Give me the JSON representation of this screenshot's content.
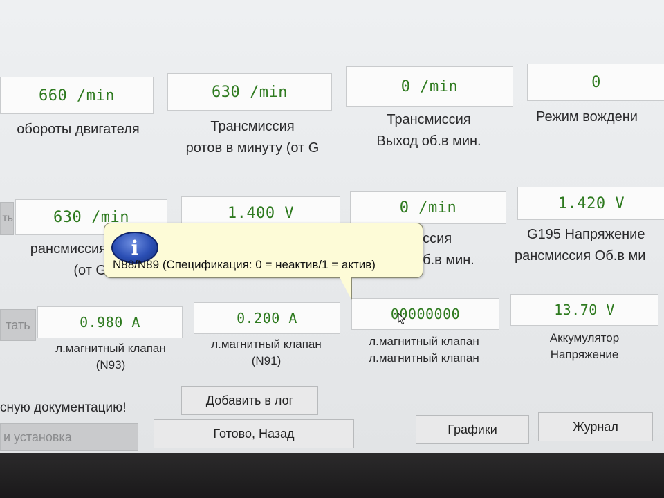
{
  "row1": {
    "values": [
      "660 /min",
      "630 /min",
      "0 /min",
      "0"
    ],
    "labels": [
      [
        "обороты двигателя",
        ""
      ],
      [
        "Трансмиссия",
        "ротов в минуту (от G"
      ],
      [
        "Трансмиссия",
        "Выход об.в мин."
      ],
      [
        "Режим вождени",
        ""
      ]
    ]
  },
  "row2": {
    "left_button": "ть",
    "values": [
      "630 /min",
      "1.400 V",
      "0 /min",
      "1.420 V"
    ],
    "labels": [
      [
        "рансмиссия",
        "(от G"
      ],
      [
        "",
        ""
      ],
      [
        "иссия",
        "об.в мин."
      ],
      [
        "G195 Напряжение",
        "рансмиссия Об.в ми"
      ]
    ]
  },
  "row3": {
    "left_button": "тать",
    "values": [
      "0.980 A",
      "0.200 A",
      "00000000",
      "13.70 V"
    ],
    "labels": [
      [
        "л.магнитный клапан",
        "(N93)"
      ],
      [
        "л.магнитный клапан",
        "(N91)"
      ],
      [
        "л.магнитный клапан",
        "л.магнитный клапан"
      ],
      [
        "Аккумулятор",
        "Напряжение"
      ]
    ]
  },
  "tooltip": {
    "icon": "info-icon",
    "text": "N88/N89 (Спецификация: 0 = неактив/1 = актив)"
  },
  "footer": {
    "doc_text": "сную документацию!",
    "add_log": "Добавить в лог",
    "install": "и установка",
    "done_back": "Готово, Назад",
    "graphs": "Графики",
    "journal": "Журнал"
  },
  "colors": {
    "value_text": "#2e7a1f",
    "tooltip_bg": "#fdfbd7",
    "screen_bg": "#eef0f2"
  }
}
